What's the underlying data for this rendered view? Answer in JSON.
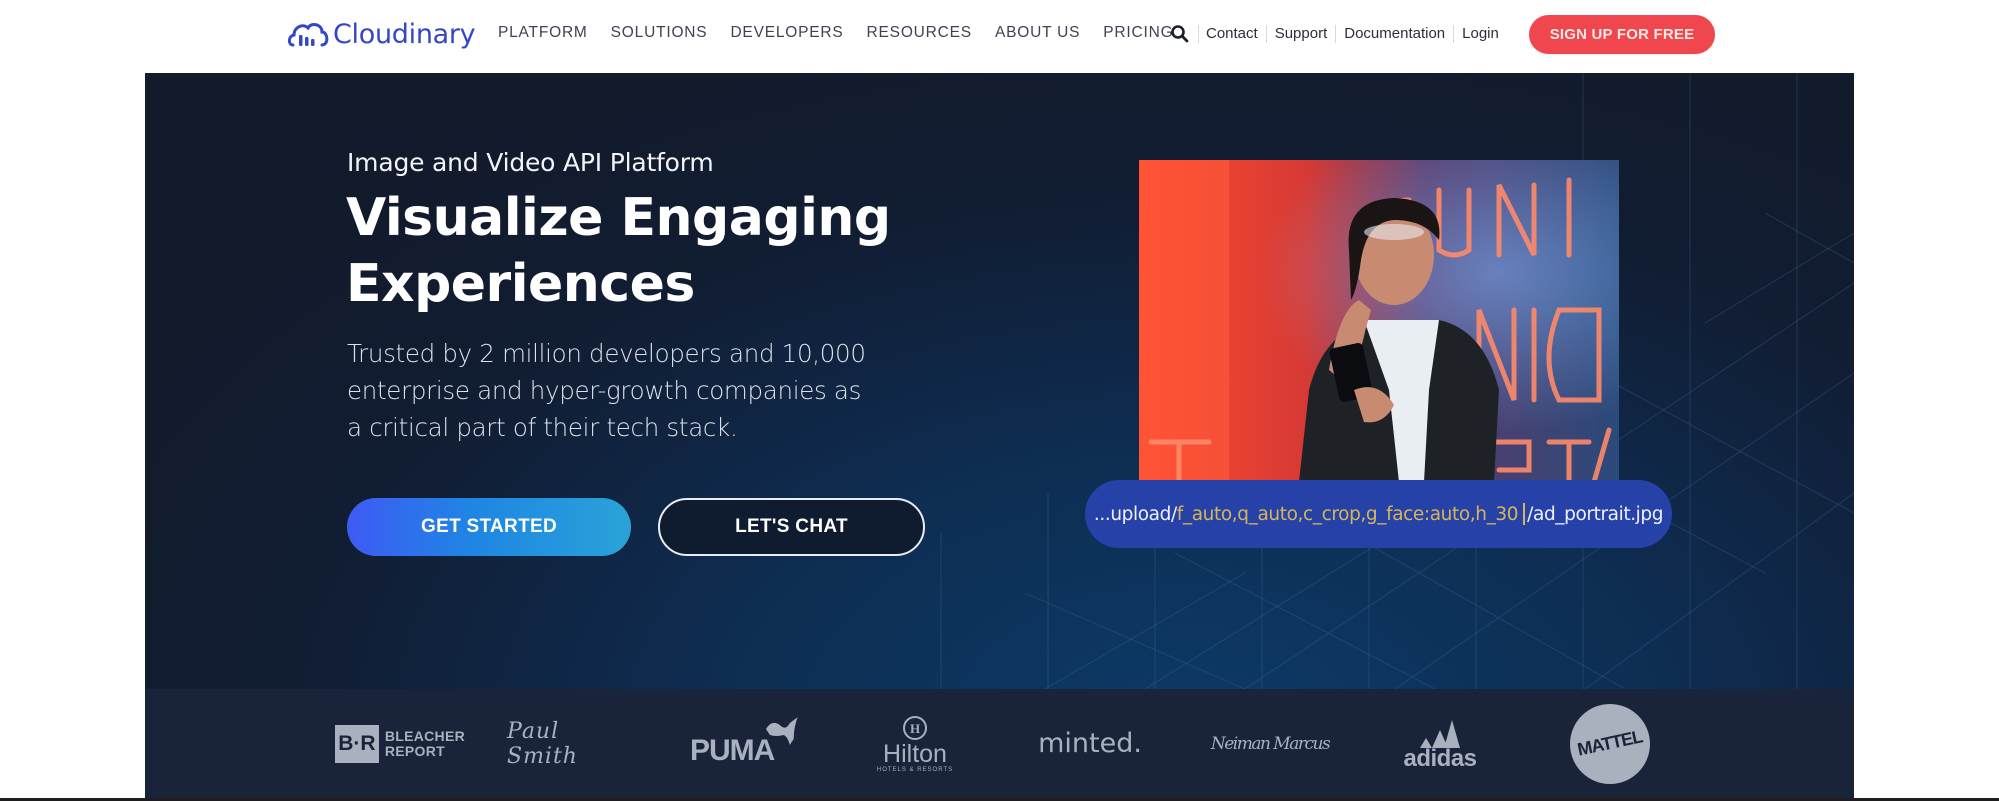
{
  "brand": {
    "name": "Cloudinary",
    "logo_icon": "cloud-bars-icon",
    "colors": {
      "brand_blue": "#3448c5",
      "signup_red": "#f0474e",
      "hero_dark": "#121b2c",
      "url_pill": "#2641a8",
      "url_params": "#d6b656",
      "logo_strip": "#19233a"
    }
  },
  "nav": {
    "main_items": [
      {
        "label": "PLATFORM"
      },
      {
        "label": "SOLUTIONS"
      },
      {
        "label": "DEVELOPERS"
      },
      {
        "label": "RESOURCES"
      },
      {
        "label": "ABOUT US"
      },
      {
        "label": "PRICING"
      }
    ],
    "search_icon": "search-icon",
    "util_items": [
      {
        "label": "Contact"
      },
      {
        "label": "Support"
      },
      {
        "label": "Documentation"
      },
      {
        "label": "Login"
      }
    ],
    "signup_label": "SIGN UP FOR FREE"
  },
  "hero": {
    "eyebrow": "Image and Video API Platform",
    "headline": "Visualize Engaging Experiences",
    "subtext": "Trusted by 2 million developers and 10,000 enterprise and hyper-growth companies as a critical part of their tech stack.",
    "primary_cta": "GET STARTED",
    "secondary_cta": "LET'S CHAT",
    "image_alt": "Woman with headphones looking up in front of neon signs",
    "url": {
      "prefix": "...upload/",
      "params": "f_auto,q_auto,c_crop,g_face:auto,h_30",
      "suffix": "/ad_portrait.jpg"
    }
  },
  "customer_logos": [
    {
      "name": "Bleacher Report",
      "mark": "B·R",
      "text_line1": "BLEACHER",
      "text_line2": "REPORT"
    },
    {
      "name": "Paul Smith",
      "text": "Paul Smith"
    },
    {
      "name": "Puma",
      "text": "PUMA"
    },
    {
      "name": "Hilton",
      "text": "Hilton",
      "subtext": "HOTELS & RESORTS"
    },
    {
      "name": "Minted",
      "text": "minted."
    },
    {
      "name": "Neiman Marcus",
      "text": "Neiman Marcus"
    },
    {
      "name": "Adidas",
      "text": "adidas"
    },
    {
      "name": "Mattel",
      "text": "MATTEL"
    }
  ]
}
